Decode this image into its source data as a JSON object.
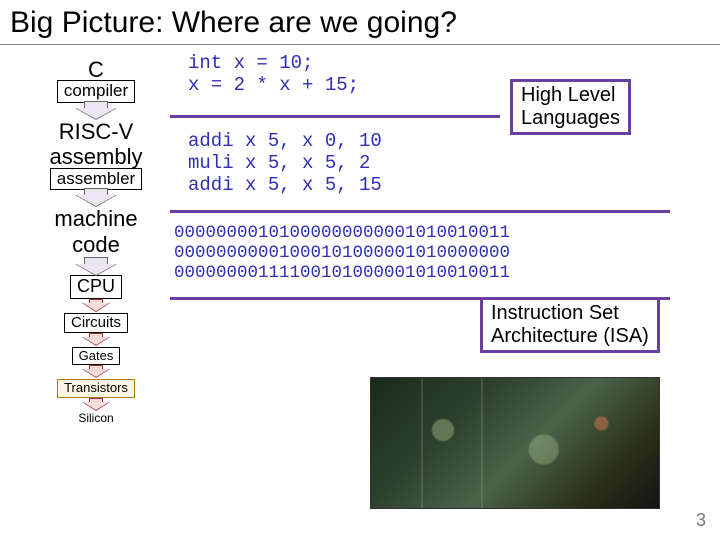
{
  "title": "Big Picture: Where are we going?",
  "slide_number": "3",
  "stages": {
    "c": "C",
    "compiler": "compiler",
    "riscv": "RISC-V\nassembly",
    "assembler": "assembler",
    "machine": "machine\ncode",
    "cpu": "CPU",
    "circuits": "Circuits",
    "gates": "Gates",
    "transistors": "Transistors",
    "silicon": "Silicon"
  },
  "code": {
    "c_code": "int x = 10;\nx = 2 * x + 15;",
    "asm_code": "addi x 5, x 0, 10\nmuli x 5, x 5, 2\naddi x 5, x 5, 15",
    "machine_code": "00000000101000000000001010010011\n00000000001000101000001010000000\n00000000111100101000001010010011"
  },
  "callouts": {
    "hll": "High Level\nLanguages",
    "isa": "Instruction Set\nArchitecture (ISA)"
  }
}
